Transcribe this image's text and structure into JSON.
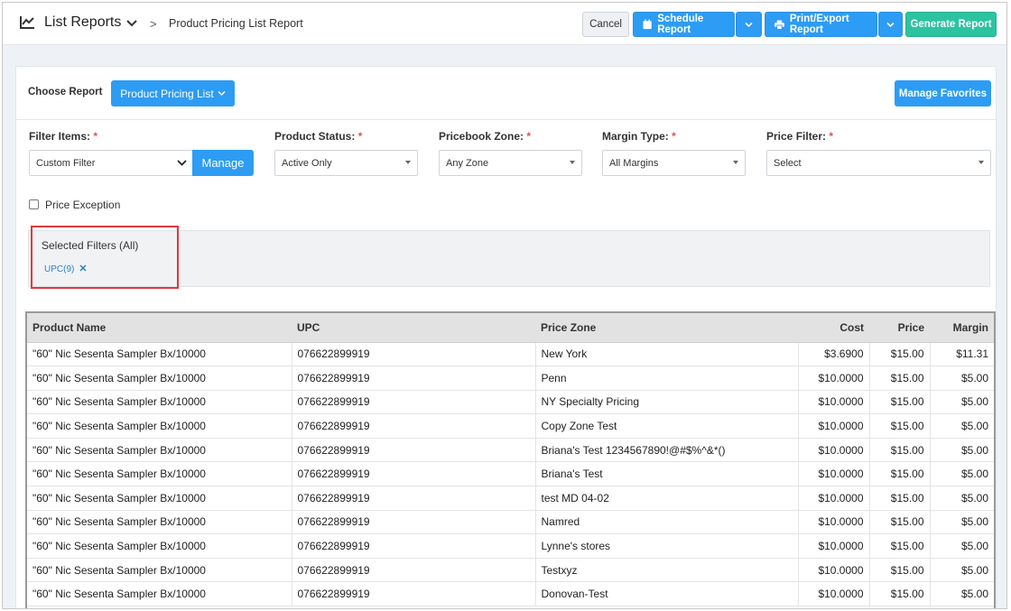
{
  "header": {
    "title": "List Reports",
    "separator": ">",
    "current": "Product Pricing List Report",
    "buttons": {
      "cancel": "Cancel",
      "schedule": "Schedule Report",
      "print": "Print/Export Report",
      "generate": "Generate Report"
    }
  },
  "choose": {
    "label": "Choose Report",
    "report": "Product Pricing List",
    "favorites": "Manage Favorites"
  },
  "filters": {
    "items": {
      "label": "Filter Items:",
      "value": "Custom Filter",
      "manage": "Manage"
    },
    "status": {
      "label": "Product Status:",
      "value": "Active Only"
    },
    "zone": {
      "label": "Pricebook Zone:",
      "value": "Any Zone"
    },
    "margin": {
      "label": "Margin Type:",
      "value": "All Margins"
    },
    "price": {
      "label": "Price Filter:",
      "value": "Select"
    },
    "required_mark": "*",
    "price_exception": "Price Exception"
  },
  "selected_filters": {
    "title": "Selected Filters (All)",
    "tag": "UPC(9)",
    "remove": "✕"
  },
  "table": {
    "columns": [
      "Product Name",
      "UPC",
      "Price Zone",
      "Cost",
      "Price",
      "Margin"
    ],
    "rows": [
      [
        "\"60\" Nic Sesenta Sampler Bx/10000",
        "076622899919",
        "New York",
        "$3.6900",
        "$15.00",
        "$11.31"
      ],
      [
        "\"60\" Nic Sesenta Sampler Bx/10000",
        "076622899919",
        "Penn",
        "$10.0000",
        "$15.00",
        "$5.00"
      ],
      [
        "\"60\" Nic Sesenta Sampler Bx/10000",
        "076622899919",
        "NY Specialty Pricing",
        "$10.0000",
        "$15.00",
        "$5.00"
      ],
      [
        "\"60\" Nic Sesenta Sampler Bx/10000",
        "076622899919",
        "Copy Zone Test",
        "$10.0000",
        "$15.00",
        "$5.00"
      ],
      [
        "\"60\" Nic Sesenta Sampler Bx/10000",
        "076622899919",
        "Briana's Test 1234567890!@#$%^&*()",
        "$10.0000",
        "$15.00",
        "$5.00"
      ],
      [
        "\"60\" Nic Sesenta Sampler Bx/10000",
        "076622899919",
        "Briana's Test",
        "$10.0000",
        "$15.00",
        "$5.00"
      ],
      [
        "\"60\" Nic Sesenta Sampler Bx/10000",
        "076622899919",
        "test MD 04-02",
        "$10.0000",
        "$15.00",
        "$5.00"
      ],
      [
        "\"60\" Nic Sesenta Sampler Bx/10000",
        "076622899919",
        "Namred",
        "$10.0000",
        "$15.00",
        "$5.00"
      ],
      [
        "\"60\" Nic Sesenta Sampler Bx/10000",
        "076622899919",
        "Lynne's stores",
        "$10.0000",
        "$15.00",
        "$5.00"
      ],
      [
        "\"60\" Nic Sesenta Sampler Bx/10000",
        "076622899919",
        "Testxyz",
        "$10.0000",
        "$15.00",
        "$5.00"
      ],
      [
        "\"60\" Nic Sesenta Sampler Bx/10000",
        "076622899919",
        "Donovan-Test",
        "$10.0000",
        "$15.00",
        "$5.00"
      ]
    ]
  },
  "icons": {
    "chart": "line-chart-icon",
    "calendar": "calendar-icon",
    "printer": "printer-icon"
  },
  "colors": {
    "primary": "#2d9cf4",
    "success": "#2cc3a0",
    "highlight": "#e0393e"
  }
}
